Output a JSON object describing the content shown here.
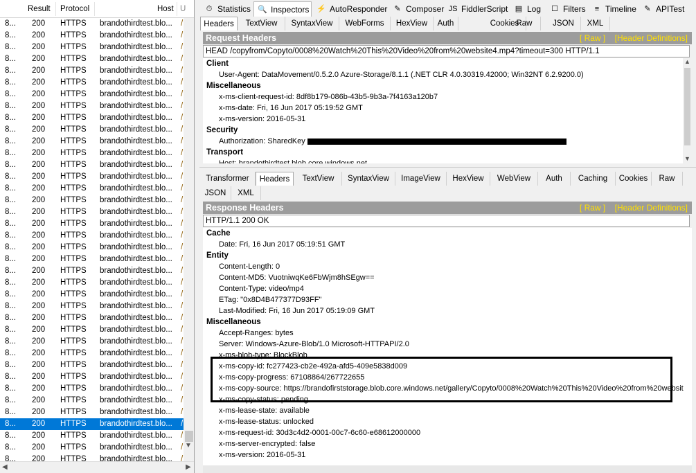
{
  "sessions": {
    "columns": {
      "result": "Result",
      "protocol": "Protocol",
      "host": "Host",
      "url": "U"
    },
    "rows": [
      {
        "num": "8...",
        "result": "200",
        "protocol": "HTTPS",
        "host": "brandothirdtest.blo..."
      },
      {
        "num": "8...",
        "result": "200",
        "protocol": "HTTPS",
        "host": "brandothirdtest.blo..."
      },
      {
        "num": "8...",
        "result": "200",
        "protocol": "HTTPS",
        "host": "brandothirdtest.blo..."
      },
      {
        "num": "8...",
        "result": "200",
        "protocol": "HTTPS",
        "host": "brandothirdtest.blo..."
      },
      {
        "num": "8...",
        "result": "200",
        "protocol": "HTTPS",
        "host": "brandothirdtest.blo..."
      },
      {
        "num": "8...",
        "result": "200",
        "protocol": "HTTPS",
        "host": "brandothirdtest.blo..."
      },
      {
        "num": "8...",
        "result": "200",
        "protocol": "HTTPS",
        "host": "brandothirdtest.blo..."
      },
      {
        "num": "8...",
        "result": "200",
        "protocol": "HTTPS",
        "host": "brandothirdtest.blo..."
      },
      {
        "num": "8...",
        "result": "200",
        "protocol": "HTTPS",
        "host": "brandothirdtest.blo..."
      },
      {
        "num": "8...",
        "result": "200",
        "protocol": "HTTPS",
        "host": "brandothirdtest.blo..."
      },
      {
        "num": "8...",
        "result": "200",
        "protocol": "HTTPS",
        "host": "brandothirdtest.blo..."
      },
      {
        "num": "8...",
        "result": "200",
        "protocol": "HTTPS",
        "host": "brandothirdtest.blo..."
      },
      {
        "num": "8...",
        "result": "200",
        "protocol": "HTTPS",
        "host": "brandothirdtest.blo..."
      },
      {
        "num": "8...",
        "result": "200",
        "protocol": "HTTPS",
        "host": "brandothirdtest.blo..."
      },
      {
        "num": "8...",
        "result": "200",
        "protocol": "HTTPS",
        "host": "brandothirdtest.blo..."
      },
      {
        "num": "8...",
        "result": "200",
        "protocol": "HTTPS",
        "host": "brandothirdtest.blo..."
      },
      {
        "num": "8...",
        "result": "200",
        "protocol": "HTTPS",
        "host": "brandothirdtest.blo..."
      },
      {
        "num": "8...",
        "result": "200",
        "protocol": "HTTPS",
        "host": "brandothirdtest.blo..."
      },
      {
        "num": "8...",
        "result": "200",
        "protocol": "HTTPS",
        "host": "brandothirdtest.blo..."
      },
      {
        "num": "8...",
        "result": "200",
        "protocol": "HTTPS",
        "host": "brandothirdtest.blo..."
      },
      {
        "num": "8...",
        "result": "200",
        "protocol": "HTTPS",
        "host": "brandothirdtest.blo..."
      },
      {
        "num": "8...",
        "result": "200",
        "protocol": "HTTPS",
        "host": "brandothirdtest.blo..."
      },
      {
        "num": "8...",
        "result": "200",
        "protocol": "HTTPS",
        "host": "brandothirdtest.blo..."
      },
      {
        "num": "8...",
        "result": "200",
        "protocol": "HTTPS",
        "host": "brandothirdtest.blo..."
      },
      {
        "num": "8...",
        "result": "200",
        "protocol": "HTTPS",
        "host": "brandothirdtest.blo..."
      },
      {
        "num": "8...",
        "result": "200",
        "protocol": "HTTPS",
        "host": "brandothirdtest.blo..."
      },
      {
        "num": "8...",
        "result": "200",
        "protocol": "HTTPS",
        "host": "brandothirdtest.blo..."
      },
      {
        "num": "8...",
        "result": "200",
        "protocol": "HTTPS",
        "host": "brandothirdtest.blo..."
      },
      {
        "num": "8...",
        "result": "200",
        "protocol": "HTTPS",
        "host": "brandothirdtest.blo..."
      },
      {
        "num": "8...",
        "result": "200",
        "protocol": "HTTPS",
        "host": "brandothirdtest.blo..."
      },
      {
        "num": "8...",
        "result": "200",
        "protocol": "HTTPS",
        "host": "brandothirdtest.blo..."
      },
      {
        "num": "8...",
        "result": "200",
        "protocol": "HTTPS",
        "host": "brandothirdtest.blo..."
      },
      {
        "num": "8...",
        "result": "200",
        "protocol": "HTTPS",
        "host": "brandothirdtest.blo..."
      },
      {
        "num": "8...",
        "result": "200",
        "protocol": "HTTPS",
        "host": "brandothirdtest.blo..."
      },
      {
        "num": "8...",
        "result": "200",
        "protocol": "HTTPS",
        "host": "brandothirdtest.blo...",
        "selected": true
      },
      {
        "num": "8...",
        "result": "200",
        "protocol": "HTTPS",
        "host": "brandothirdtest.blo..."
      },
      {
        "num": "8...",
        "result": "200",
        "protocol": "HTTPS",
        "host": "brandothirdtest.blo..."
      },
      {
        "num": "8...",
        "result": "200",
        "protocol": "HTTPS",
        "host": "brandothirdtest.blo..."
      }
    ]
  },
  "top_tabs": [
    {
      "label": "Statistics",
      "icon": "stopwatch-icon",
      "glyph": "⏱"
    },
    {
      "label": "Inspectors",
      "icon": "inspect-icon",
      "glyph": "🔍",
      "active": true
    },
    {
      "label": "AutoResponder",
      "icon": "lightning-icon",
      "glyph": "⚡"
    },
    {
      "label": "Composer",
      "icon": "compose-icon",
      "glyph": "✎"
    },
    {
      "label": "FiddlerScript",
      "icon": "script-icon",
      "glyph": "JS"
    },
    {
      "label": "Log",
      "icon": "log-icon",
      "glyph": "▤"
    },
    {
      "label": "Filters",
      "icon": "checkbox-icon",
      "glyph": "☐"
    },
    {
      "label": "Timeline",
      "icon": "timeline-icon",
      "glyph": "≡"
    },
    {
      "label": "APITest",
      "icon": "apitest-icon",
      "glyph": "✎"
    }
  ],
  "request": {
    "subtabs": [
      "Headers",
      "TextView",
      "SyntaxView",
      "WebForms",
      "HexView",
      "Auth",
      "Cookies",
      "Raw",
      "JSON",
      "XML"
    ],
    "active_subtab": "Headers",
    "title": "Request Headers",
    "links": [
      "[ Raw ]",
      "[Header Definitions]"
    ],
    "request_line": "HEAD /copyfrom/Copyto/0008%20Watch%20This%20Video%20from%20website4.mp4?timeout=300 HTTP/1.1",
    "groups": [
      {
        "name": "Client",
        "lines": [
          "User-Agent: DataMovement/0.5.2.0 Azure-Storage/8.1.1 (.NET CLR 4.0.30319.42000; Win32NT 6.2.9200.0)"
        ]
      },
      {
        "name": "Miscellaneous",
        "lines": [
          "x-ms-client-request-id: 8df8b179-086b-43b5-9b3a-7f4163a120b7",
          "x-ms-date: Fri, 16 Jun 2017 05:19:52 GMT",
          "x-ms-version: 2016-05-31"
        ]
      },
      {
        "name": "Security",
        "lines": [
          "Authorization: SharedKey"
        ]
      },
      {
        "name": "Transport",
        "lines": [
          "Host: brandothirdtest.blob.core.windows.net"
        ]
      }
    ]
  },
  "response": {
    "subtabs_row1": [
      "Transformer",
      "Headers",
      "TextView",
      "SyntaxView",
      "ImageView",
      "HexView",
      "WebView",
      "Auth",
      "Caching",
      "Cookies",
      "Raw"
    ],
    "subtabs_row2": [
      "JSON",
      "XML"
    ],
    "active_subtab": "Headers",
    "title": "Response Headers",
    "links": [
      "[ Raw ]",
      "[Header Definitions]"
    ],
    "status_line": "HTTP/1.1 200 OK",
    "groups": [
      {
        "name": "Cache",
        "lines": [
          "Date: Fri, 16 Jun 2017 05:19:51 GMT"
        ]
      },
      {
        "name": "Entity",
        "lines": [
          "Content-Length: 0",
          "Content-MD5: VuotniwqKe6FbWjm8hSEgw==",
          "Content-Type: video/mp4",
          "ETag: \"0x8D4B477377D93FF\"",
          "Last-Modified: Fri, 16 Jun 2017 05:19:09 GMT"
        ]
      },
      {
        "name": "Miscellaneous",
        "lines": [
          "Accept-Ranges: bytes",
          "Server: Windows-Azure-Blob/1.0 Microsoft-HTTPAPI/2.0",
          "x-ms-blob-type: BlockBlob",
          "x-ms-copy-id: fc277423-cb2e-492a-afd5-409e5838d009",
          "x-ms-copy-progress: 67108864/267722655",
          "x-ms-copy-source: https://brandofirststorage.blob.core.windows.net/gallery/Copyto/0008%20Watch%20This%20Video%20from%20websit",
          "x-ms-copy-status: pending",
          "x-ms-lease-state: available",
          "x-ms-lease-status: unlocked",
          "x-ms-request-id: 30d3c4d2-0001-00c7-6c60-e68612000000",
          "x-ms-server-encrypted: false",
          "x-ms-version: 2016-05-31"
        ]
      }
    ]
  },
  "colors": {
    "selection": "#0078d7",
    "panel_bar": "#9c9c9c",
    "link_yellow": "#ffe000"
  }
}
